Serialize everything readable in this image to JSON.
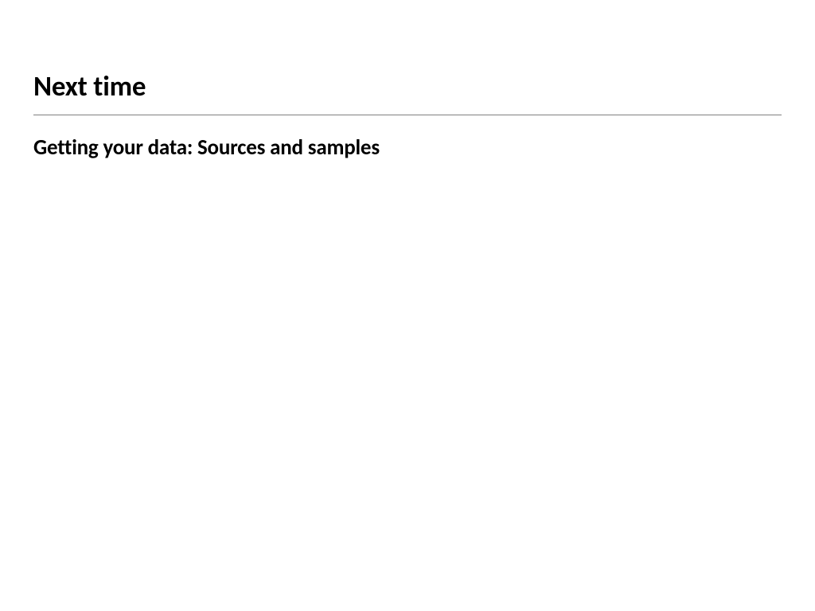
{
  "slide": {
    "heading": "Next time",
    "subheading": "Getting your data: Sources and samples"
  }
}
